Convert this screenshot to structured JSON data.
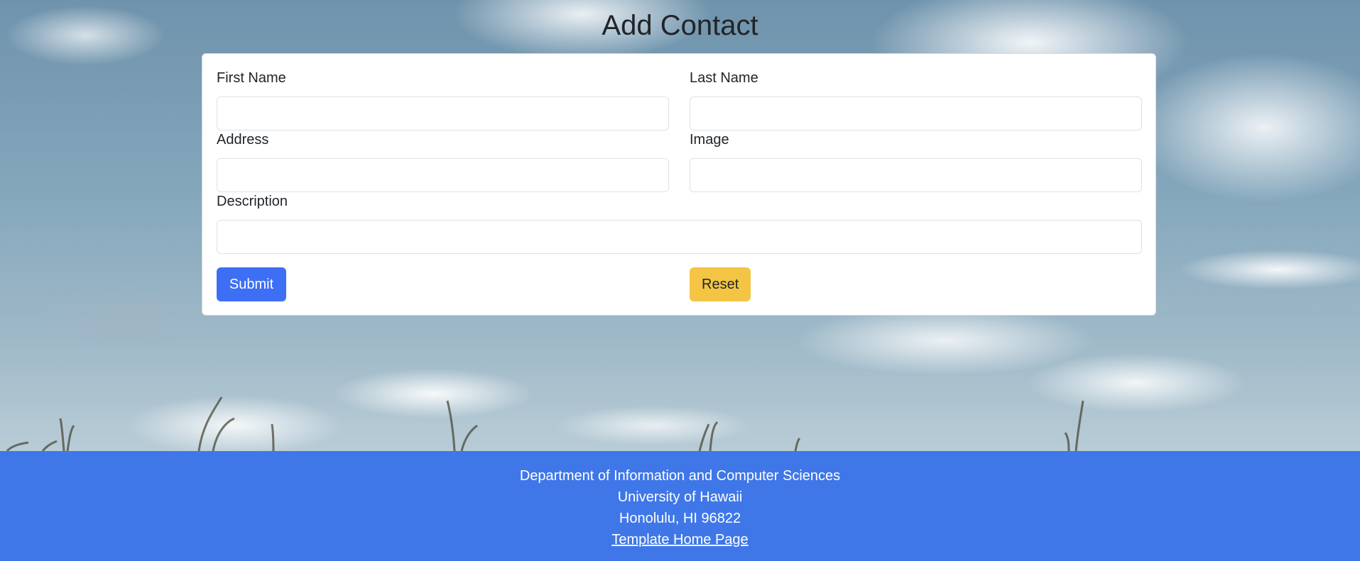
{
  "page": {
    "title": "Add Contact"
  },
  "form": {
    "first_name": {
      "label": "First Name",
      "value": "",
      "placeholder": ""
    },
    "last_name": {
      "label": "Last Name",
      "value": "",
      "placeholder": ""
    },
    "address": {
      "label": "Address",
      "value": "",
      "placeholder": ""
    },
    "image": {
      "label": "Image",
      "value": "",
      "placeholder": ""
    },
    "description": {
      "label": "Description",
      "value": "",
      "placeholder": ""
    },
    "submit_label": "Submit",
    "reset_label": "Reset"
  },
  "footer": {
    "line1": "Department of Information and Computer Sciences",
    "line2": "University of Hawaii",
    "line3": "Honolulu, HI 96822",
    "link_label": "Template Home Page"
  },
  "colors": {
    "primary": "#3d6ff5",
    "warning": "#f4c544",
    "footer_bg": "#3f77e8"
  }
}
